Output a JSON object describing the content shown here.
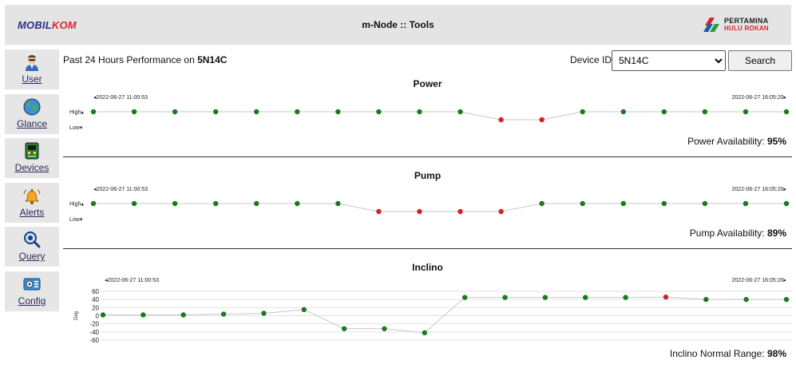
{
  "header": {
    "brand_part1": "MOBIL",
    "brand_part2": "KOM",
    "title": "m-Node :: Tools",
    "logo_line1": "PERTAMINA",
    "logo_line2": "HULU ROKAN"
  },
  "sidebar": {
    "items": [
      {
        "label": "User",
        "icon": "user-icon"
      },
      {
        "label": "Glance",
        "icon": "globe-icon"
      },
      {
        "label": "Devices",
        "icon": "device-board-icon"
      },
      {
        "label": "Alerts",
        "icon": "bell-icon"
      },
      {
        "label": "Query",
        "icon": "magnifier-icon"
      },
      {
        "label": "Config",
        "icon": "config-panel-icon"
      }
    ]
  },
  "toolbar": {
    "title_prefix": "Past 24 Hours Performance on",
    "device": "5N14C",
    "device_label": "Device ID",
    "device_selected": "5N14C",
    "search_label": "Search"
  },
  "colors": {
    "ok": "#1b7a1b",
    "alert": "#d32222",
    "line": "#c8c8c8",
    "grid": "#e2e2e2"
  },
  "chart_data": [
    {
      "type": "line",
      "title": "Power",
      "start_label": "◂2022-06-27 11:00:53",
      "end_label": "2022-06-27 16:05:20▸",
      "y_labels": [
        "High▴",
        "Low▾"
      ],
      "values": [
        1,
        1,
        1,
        1,
        1,
        1,
        1,
        1,
        1,
        1,
        0,
        0,
        1,
        1,
        1,
        1,
        1,
        1
      ],
      "availability_label": "Power Availability:",
      "availability_value": "95%"
    },
    {
      "type": "line",
      "title": "Pump",
      "start_label": "◂2022-06-27 11:00:53",
      "end_label": "2022-06-27 16:05:20▸",
      "y_labels": [
        "High▴",
        "Low▾"
      ],
      "values": [
        1,
        1,
        1,
        1,
        1,
        1,
        1,
        0,
        0,
        0,
        0,
        1,
        1,
        1,
        1,
        1,
        1,
        1
      ],
      "availability_label": "Pump Availability:",
      "availability_value": "89%"
    },
    {
      "type": "line",
      "title": "Inclino",
      "start_label": "◂2022-06-27 11:00:53",
      "end_label": "2022-06-27 16:05:20▸",
      "ylabel": "Deg",
      "yticks": [
        60,
        40,
        20,
        0,
        -20,
        -40,
        -60
      ],
      "ylim": [
        -60,
        60
      ],
      "values": [
        2,
        2,
        2,
        4,
        6,
        15,
        -32,
        -32,
        -42,
        45,
        45,
        45,
        45,
        45,
        46,
        40,
        40,
        40
      ],
      "alert_index": 14,
      "availability_label": "Inclino Normal Range:",
      "availability_value": "98%"
    }
  ]
}
